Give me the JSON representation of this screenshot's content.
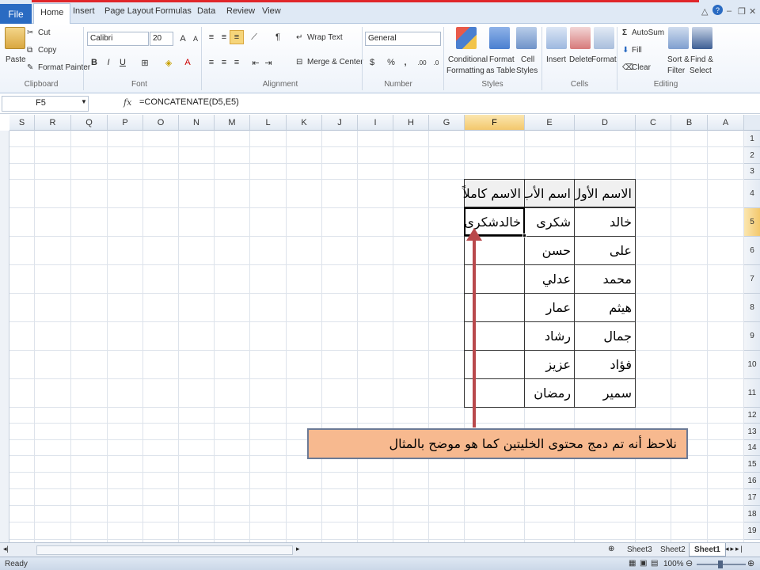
{
  "ribbon_tabs": {
    "file": "File",
    "home": "Home",
    "insert": "Insert",
    "page_layout": "Page Layout",
    "formulas": "Formulas",
    "data": "Data",
    "review": "Review",
    "view": "View"
  },
  "clipboard": {
    "paste": "Paste",
    "cut": "Cut",
    "copy": "Copy",
    "format_painter": "Format Painter",
    "label": "Clipboard"
  },
  "font": {
    "name": "Calibri",
    "size": "20",
    "bold": "B",
    "italic": "I",
    "underline": "U",
    "label": "Font"
  },
  "alignment": {
    "wrap_text": "Wrap Text",
    "merge_center": "Merge & Center",
    "label": "Alignment"
  },
  "number": {
    "format": "General",
    "currency": "$",
    "percent": "%",
    "comma": ",",
    "inc_decimal": ".00",
    "dec_decimal": ".0",
    "label": "Number"
  },
  "styles": {
    "conditional_1": "Conditional",
    "conditional_2": "Formatting",
    "format_table_1": "Format",
    "format_table_2": "as Table",
    "cell_styles_1": "Cell",
    "cell_styles_2": "Styles",
    "label": "Styles"
  },
  "cells": {
    "insert": "Insert",
    "delete": "Delete",
    "format": "Format",
    "label": "Cells"
  },
  "editing": {
    "autosum": "AutoSum",
    "fill": "Fill",
    "clear": "Clear",
    "sort_1": "Sort &",
    "sort_2": "Filter",
    "find_1": "Find &",
    "find_2": "Select",
    "label": "Editing"
  },
  "formula_bar": {
    "name_box": "F5",
    "fx": "fx",
    "formula": "=CONCATENATE(D5,E5)"
  },
  "columns": [
    "S",
    "R",
    "Q",
    "P",
    "O",
    "N",
    "M",
    "L",
    "K",
    "J",
    "I",
    "H",
    "G",
    "F",
    "E",
    "D",
    "C",
    "B",
    "A"
  ],
  "selected_column": "F",
  "rows": [
    "1",
    "2",
    "3",
    "4",
    "5",
    "6",
    "7",
    "8",
    "9",
    "10",
    "11",
    "12",
    "13",
    "14",
    "15",
    "16",
    "17",
    "18",
    "19"
  ],
  "selected_row": "5",
  "table": {
    "header": {
      "first_name": "الاسم الأول",
      "father_name": "اسم الأب",
      "full_name": "الاسم كاملاً"
    },
    "rows": [
      {
        "first": "خالد",
        "father": "شكرى",
        "full": "خالدشكرى"
      },
      {
        "first": "على",
        "father": "حسن",
        "full": ""
      },
      {
        "first": "محمد",
        "father": "عدلي",
        "full": ""
      },
      {
        "first": "هيثم",
        "father": "عمار",
        "full": ""
      },
      {
        "first": "جمال",
        "father": "رشاد",
        "full": ""
      },
      {
        "first": "فؤاد",
        "father": "عزيز",
        "full": ""
      },
      {
        "first": "سمير",
        "father": "رمضان",
        "full": ""
      }
    ]
  },
  "callout": "نلاحظ أنه تم دمج محتوى الخليتين كما هو موضح بالمثال",
  "sheets": [
    "Sheet3",
    "Sheet2",
    "Sheet1"
  ],
  "active_sheet": "Sheet1",
  "status": {
    "ready": "Ready",
    "zoom": "100%"
  },
  "colors": {
    "arrow": "#b9494c",
    "callout_fill": "#f7b98f",
    "file_tab": "#2a6bc2",
    "selection_header": "#f3c86c"
  }
}
